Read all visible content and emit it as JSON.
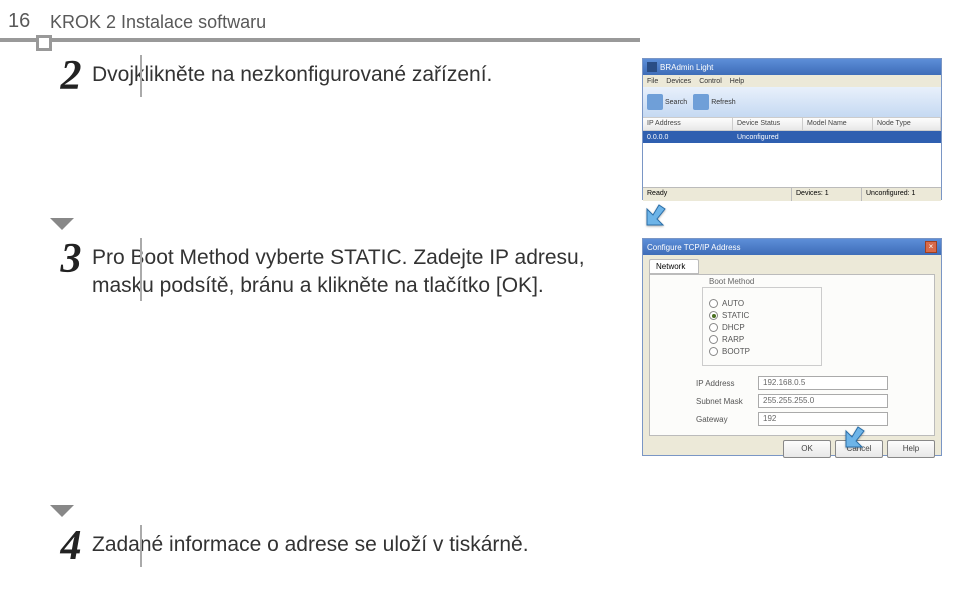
{
  "page": {
    "number": "16",
    "header": "KROK 2 Instalace softwaru"
  },
  "steps": {
    "s2": {
      "num": "2",
      "text": "Dvojklikněte na nezkonfigurované zařízení."
    },
    "s3": {
      "num": "3",
      "text": "Pro Boot Method vyberte STATIC. Zadejte IP adresu, masku podsítě, bránu a klikněte na tlačítko [OK]."
    },
    "s4": {
      "num": "4",
      "text": "Zadané informace o adrese se uloží v tiskárně."
    }
  },
  "screenshot1": {
    "title": "BRAdmin Light",
    "menu": [
      "File",
      "Devices",
      "Control",
      "Help"
    ],
    "toolbar": {
      "search": "Search",
      "refresh": "Refresh"
    },
    "columns": [
      "IP Address",
      "Device Status",
      "Model Name",
      "Node Type"
    ],
    "row": {
      "ip": "0.0.0.0",
      "status": "Unconfigured"
    },
    "statusbar": {
      "ready": "Ready",
      "devices": "Devices: 1",
      "unconfigured": "Unconfigured: 1"
    }
  },
  "screenshot2": {
    "title": "Configure TCP/IP Address",
    "tab": "Network",
    "group_label": "Boot Method",
    "radios": {
      "auto": "AUTO",
      "static": "STATIC",
      "dhcp": "DHCP",
      "rarp": "RARP",
      "bootp": "BOOTP"
    },
    "fields": {
      "ip_label": "IP Address",
      "ip_value": "192.168.0.5",
      "mask_label": "Subnet Mask",
      "mask_value": "255.255.255.0",
      "gw_label": "Gateway",
      "gw_value": "192"
    },
    "buttons": {
      "ok": "OK",
      "cancel": "Cancel",
      "help": "Help"
    }
  }
}
